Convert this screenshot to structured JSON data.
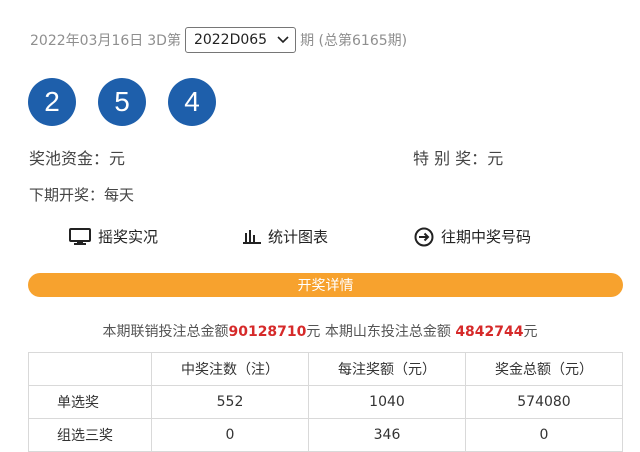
{
  "header": {
    "date": "2022年03月16日",
    "game": "3D第",
    "issue_selected": "2022D065",
    "period_suffix": "期 (总第6165期)"
  },
  "balls": [
    "2",
    "5",
    "4"
  ],
  "pool": {
    "label": "奖池资金：",
    "value": "元"
  },
  "special": {
    "label": "特 别 奖：",
    "value": "元"
  },
  "next_draw": {
    "label": "下期开奖：",
    "value": "每天"
  },
  "links": {
    "live": "摇奖实况",
    "chart": "统计图表",
    "history": "往期中奖号码"
  },
  "details_bar": "开奖详情",
  "sales": {
    "prefix": "本期联销投注总金额",
    "joint_amount": "90128710",
    "mid": "元 本期山东投注总金额 ",
    "shandong_amount": "4842744",
    "suffix": "元"
  },
  "table": {
    "headers": [
      "",
      "中奖注数（注）",
      "每注奖额（元）",
      "奖金总额（元）"
    ],
    "rows": [
      [
        "单选奖",
        "552",
        "1040",
        "574080"
      ],
      [
        "组选三奖",
        "0",
        "346",
        "0"
      ]
    ]
  },
  "icons": {
    "live": "monitor-icon",
    "chart": "bar-chart-icon",
    "history": "arrow-circle-right-icon",
    "select": "chevron-down-icon"
  },
  "colors": {
    "ball": "#1e5fab",
    "bar": "#f7a22e",
    "highlight": "#d62a2a"
  }
}
